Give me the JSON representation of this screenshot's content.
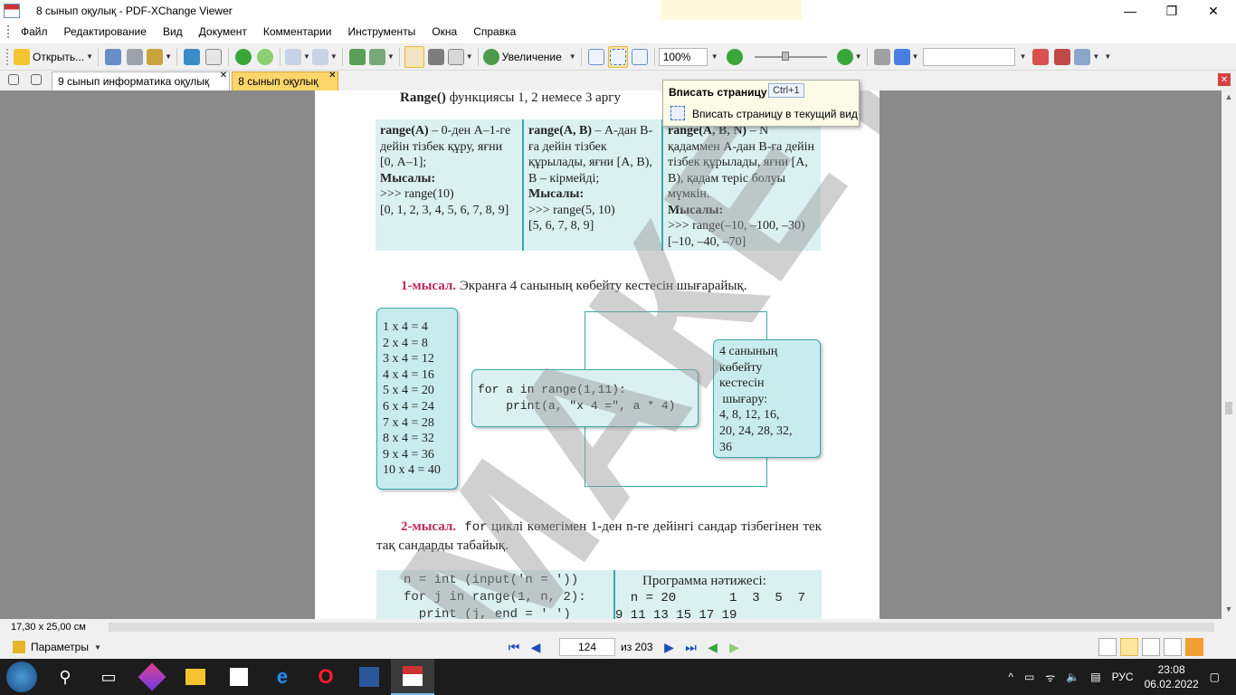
{
  "window": {
    "title": "8 сынып оқулық - PDF-XChange Viewer",
    "minimize": "—",
    "maximize": "❐",
    "close": "✕"
  },
  "menu": [
    "Файл",
    "Редактирование",
    "Вид",
    "Документ",
    "Комментарии",
    "Инструменты",
    "Окна",
    "Справка"
  ],
  "toolbar": {
    "open_label": "Открыть...",
    "zoom_label": "Увеличение",
    "zoom_value": "100%",
    "search_value": ""
  },
  "tabs": [
    {
      "label": "9 сынып информатика оқулық",
      "active": false
    },
    {
      "label": "8 сынып оқулық",
      "active": true
    }
  ],
  "tooltip": {
    "title": "Вписать страницу",
    "shortcut": "Ctrl+1",
    "description": "Вписать страницу в текущий вид"
  },
  "page": {
    "heading_bold": "Range()",
    "heading_rest": " функциясы 1, 2 немесе 3 аргу",
    "range_table": {
      "c1_bold": "range(A)",
      "c1_text1": " – 0-ден А–1-ге дейін тізбек құру, яғни [0, А–1];",
      "c1_example_label": "Мысалы:",
      "c1_code": ">>> range(10)",
      "c1_result": "[0, 1, 2, 3, 4, 5, 6, 7, 8, 9]",
      "c2_bold": "range(A, B)",
      "c2_text1": " – А-дан В-ға дейін тізбек құрылады, яғни [A, B), B – кірмейді;",
      "c2_example_label": "Мысалы:",
      "c2_code": ">>> range(5, 10)",
      "c2_result": "[5, 6, 7, 8, 9]",
      "c3_bold": "range(A, B, N)",
      "c3_text1": " – N қадаммен А-дан В-ға дейін тізбек құрылады, яғни [A, B), қадам теріс болуы мүмкін.",
      "c3_example_label": "Мысалы:",
      "c3_code": ">>> range(–10, –100, –30)",
      "c3_result": "[–10, –40, –70]"
    },
    "example1_label": "1-мысал.",
    "example1_text": " Экранға 4 санының көбейту кестесін шығарайық.",
    "mult_lines": [
      "1 x 4 = 4",
      "2 x 4 = 8",
      "3 x 4 = 12",
      "4 x 4 = 16",
      "5 x 4 = 20",
      "6 x 4 = 24",
      "7 x 4 = 28",
      "8 x 4 = 32",
      "9 x 4 = 36",
      "10 x 4 = 40"
    ],
    "code1_line1": "for a in range(1,11):",
    "code1_line2": "    print(a, \"x 4 =\", a * 4)",
    "out_lines": [
      "4 санының",
      "көбейту",
      "кестесін",
      " шығару:",
      "4, 8, 12, 16,",
      "20, 24, 28, 32,",
      "36"
    ],
    "example2_label": "2-мысал.",
    "example2_mono": " for",
    "example2_text": " циклі көмегімен 1-ден n-ге дейінгі сандар тізбегінен тек тақ сандарды табайық.",
    "code2_lines": [
      "n = int (input('n = '))",
      "for j in range(1, n, 2):",
      "  print (j, end = ' ')"
    ],
    "result_title": "Программа нәтижесі:",
    "result_line1": "  n = 20       1  3  5  7",
    "result_line2": "9 11 13 15 17 19",
    "watermark": "МАКЕТ"
  },
  "status": {
    "page_size": "17,30 x 25,00 см",
    "params_label": "Параметры",
    "current_page": "124",
    "total_pages": "из 203"
  },
  "taskbar": {
    "language": "РУС",
    "time": "23:08",
    "date": "06.02.2022"
  }
}
